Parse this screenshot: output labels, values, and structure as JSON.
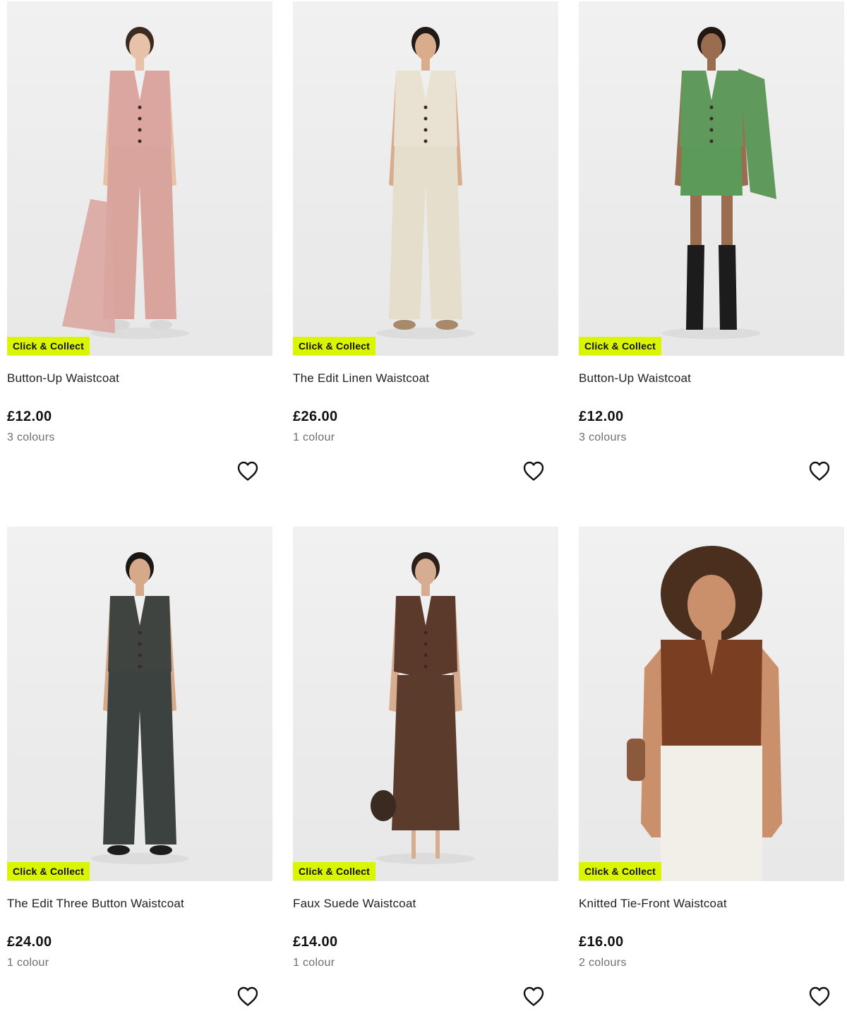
{
  "colors": {
    "badge_bg": "#d9f500",
    "text": "#1a1a1a",
    "muted": "#6e6e6e",
    "image_bg": "#ededed"
  },
  "products": [
    {
      "badge": "Click & Collect",
      "name": "Button-Up Waistcoat",
      "price": "£12.00",
      "colours": "3 colours",
      "wishlist_icon": "heart-outline-icon",
      "outfit": {
        "top": "#dba6a0",
        "bottom": "#d8a49c",
        "hair": "#3a2a22",
        "skin": "#e8c2a8",
        "shoes": "#d8d8d8",
        "extra": "jacket-in-hand"
      }
    },
    {
      "badge": "Click & Collect",
      "name": "The Edit Linen Waistcoat",
      "price": "£26.00",
      "colours": "1 colour",
      "wishlist_icon": "heart-outline-icon",
      "outfit": {
        "top": "#e9e2d2",
        "bottom": "#e5decd",
        "hair": "#1f1a17",
        "skin": "#d9ad8c",
        "shoes": "#a88a6a",
        "extra": "none"
      }
    },
    {
      "badge": "Click & Collect",
      "name": "Button-Up Waistcoat",
      "price": "£12.00",
      "colours": "3 colours",
      "wishlist_icon": "heart-outline-icon",
      "outfit": {
        "top": "#5f9a5c",
        "bottom": "#5c9a59",
        "hair": "#211812",
        "skin": "#9a6c50",
        "shoes": "#1c1c1c",
        "extra": "jacket-on-shoulder"
      }
    },
    {
      "badge": "Click & Collect",
      "name": "The Edit Three Button Waistcoat",
      "price": "£24.00",
      "colours": "1 colour",
      "wishlist_icon": "heart-outline-icon",
      "outfit": {
        "top": "#3f4441",
        "bottom": "#3c423f",
        "hair": "#1a1714",
        "skin": "#d6a98a",
        "shoes": "#1c1c1c",
        "extra": "none"
      }
    },
    {
      "badge": "Click & Collect",
      "name": "Faux Suede Waistcoat",
      "price": "£14.00",
      "colours": "1 colour",
      "wishlist_icon": "heart-outline-icon",
      "outfit": {
        "top": "#5b3a2b",
        "bottom": "#5a3b2c",
        "hair": "#2a1f19",
        "skin": "#d7ad92",
        "shoes": "#3a2a20",
        "extra": "bag"
      }
    },
    {
      "badge": "Click & Collect",
      "name": "Knitted Tie-Front Waistcoat",
      "price": "£16.00",
      "colours": "2 colours",
      "wishlist_icon": "heart-outline-icon",
      "outfit": {
        "top": "#7a3f22",
        "bottom": "#f2efe8",
        "hair": "#4a2e1e",
        "skin": "#c9906b",
        "shoes": "#7a3f22",
        "extra": "curly-hair"
      }
    }
  ]
}
